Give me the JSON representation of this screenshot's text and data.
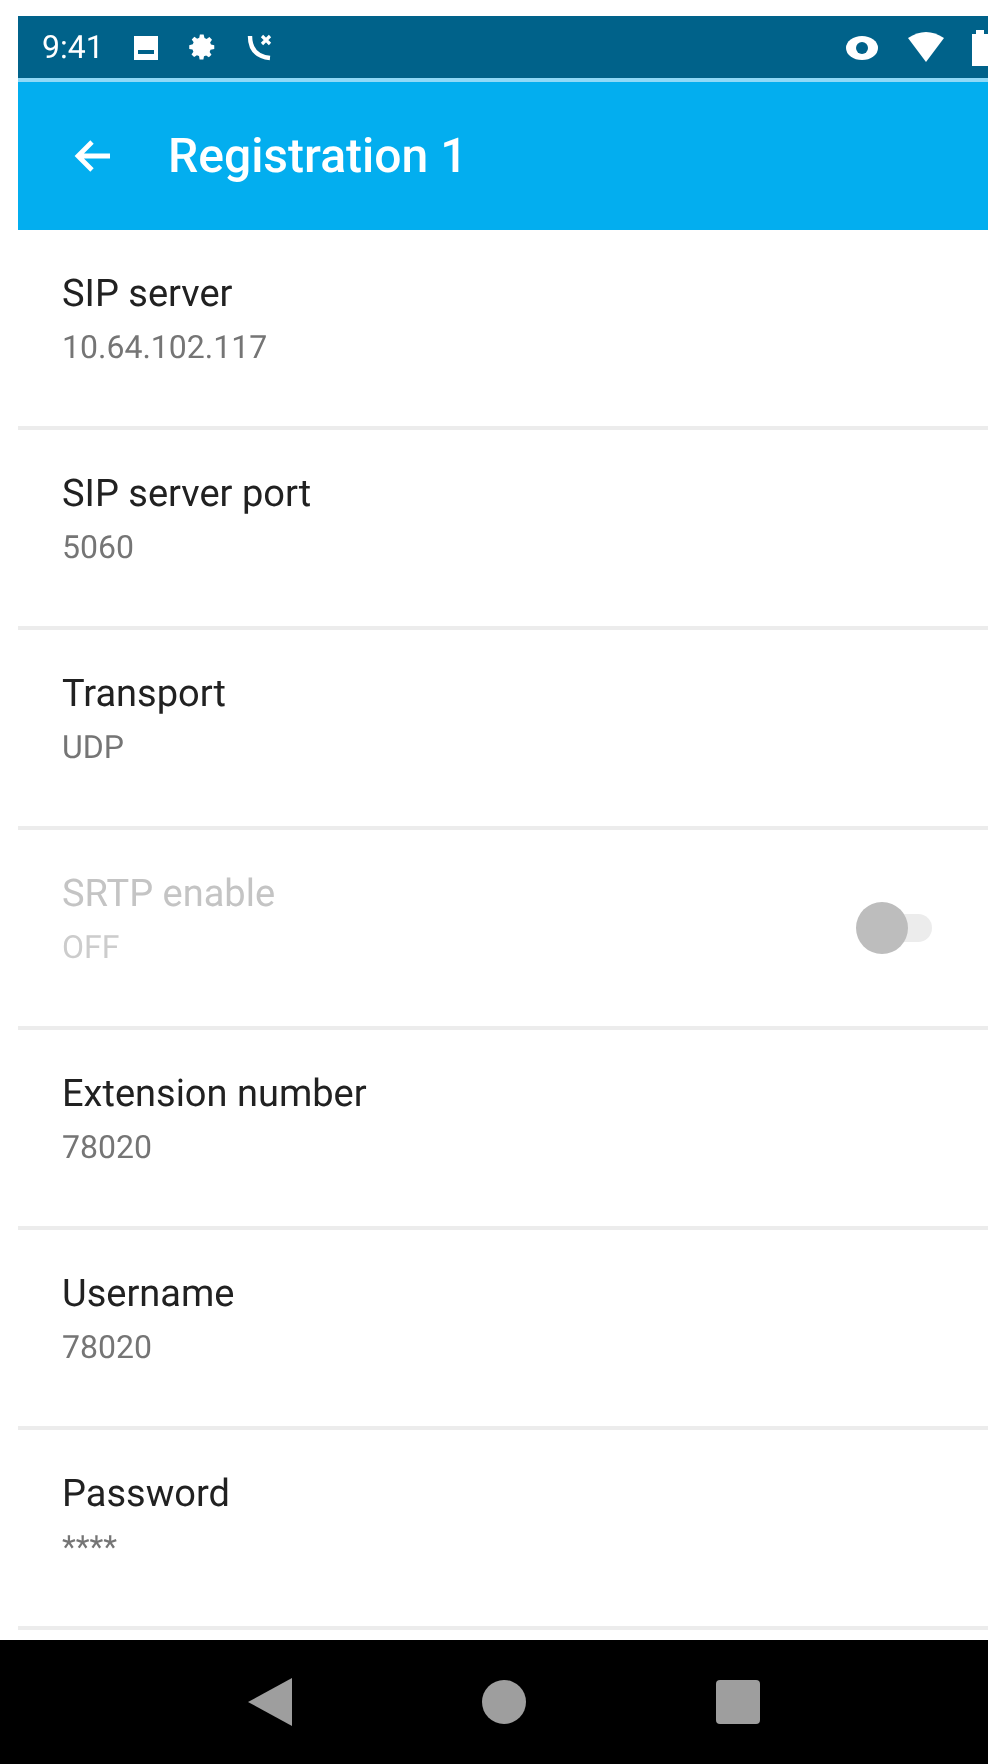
{
  "status_bar": {
    "time": "9:41"
  },
  "app_bar": {
    "title": "Registration 1"
  },
  "settings": [
    {
      "kind": "text",
      "title": "SIP server",
      "summary": "10.64.102.117",
      "disabled": false
    },
    {
      "kind": "text",
      "title": "SIP server port",
      "summary": "5060",
      "disabled": false
    },
    {
      "kind": "text",
      "title": "Transport",
      "summary": "UDP",
      "disabled": false
    },
    {
      "kind": "switch",
      "title": "SRTP enable",
      "summary": "OFF",
      "disabled": true,
      "on": false
    },
    {
      "kind": "text",
      "title": "Extension number",
      "summary": "78020",
      "disabled": false
    },
    {
      "kind": "text",
      "title": "Username",
      "summary": "78020",
      "disabled": false
    },
    {
      "kind": "text",
      "title": "Password",
      "summary": "****",
      "disabled": false
    }
  ]
}
